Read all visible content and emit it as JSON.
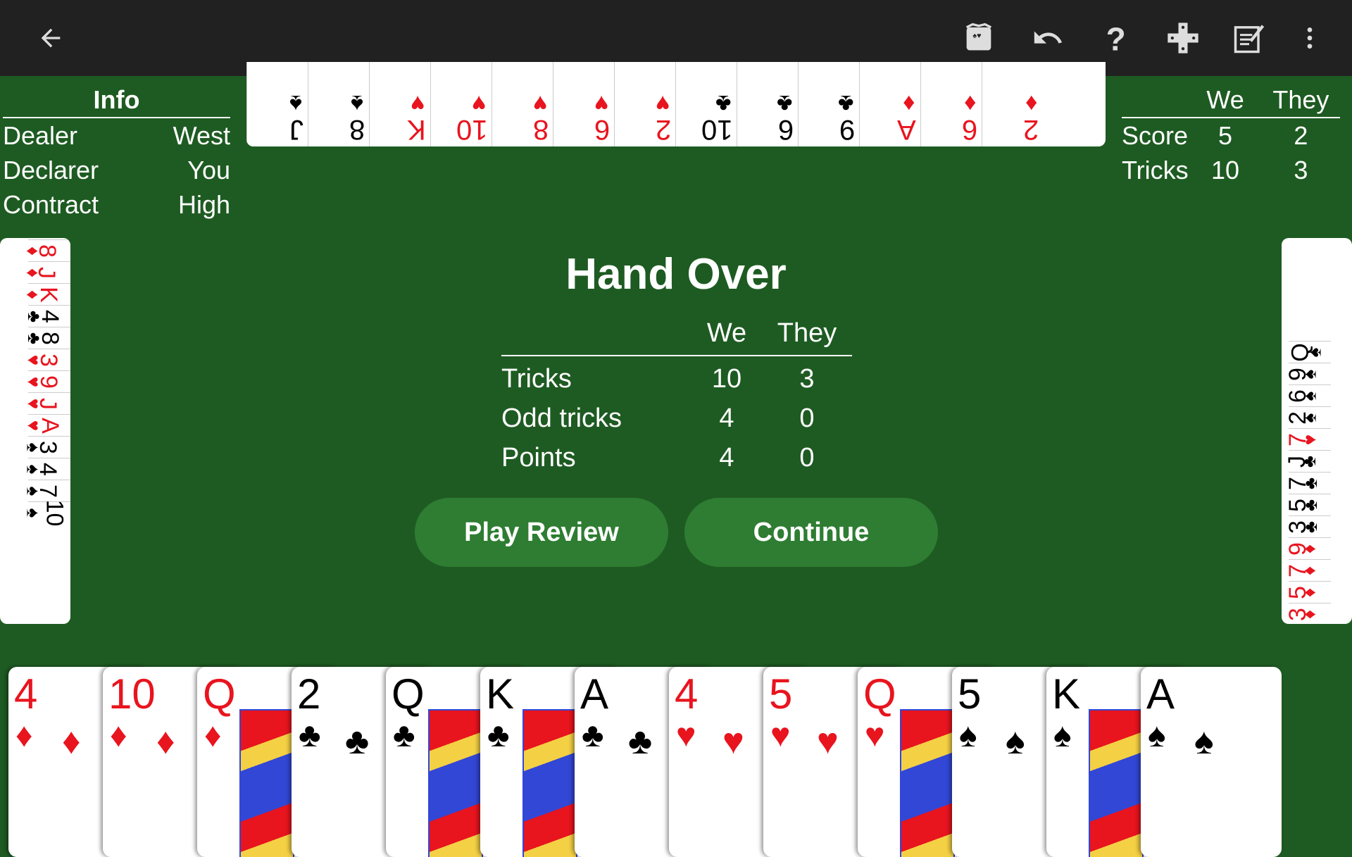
{
  "toolbar": {
    "icons": [
      "back-arrow-icon",
      "cards-icon",
      "undo-icon",
      "help-icon",
      "dpad-icon",
      "notes-icon",
      "more-vert-icon"
    ]
  },
  "info": {
    "header": "Info",
    "rows": [
      {
        "label": "Dealer",
        "value": "West"
      },
      {
        "label": "Declarer",
        "value": "You"
      },
      {
        "label": "Contract",
        "value": "High"
      }
    ]
  },
  "score": {
    "col_we": "We",
    "col_they": "They",
    "rows": [
      {
        "label": "Score",
        "we": "5",
        "they": "2"
      },
      {
        "label": "Tricks",
        "we": "10",
        "they": "3"
      }
    ]
  },
  "dialog": {
    "title": "Hand Over",
    "col_we": "We",
    "col_they": "They",
    "rows": [
      {
        "label": "Tricks",
        "we": "10",
        "they": "3"
      },
      {
        "label": "Odd tricks",
        "we": "4",
        "they": "0"
      },
      {
        "label": "Points",
        "we": "4",
        "they": "0"
      }
    ],
    "play_review": "Play Review",
    "continue": "Continue"
  },
  "north_hand": [
    {
      "rank": "J",
      "suit": "♠",
      "color": "blk"
    },
    {
      "rank": "8",
      "suit": "♠",
      "color": "blk"
    },
    {
      "rank": "K",
      "suit": "♥",
      "color": "red"
    },
    {
      "rank": "10",
      "suit": "♥",
      "color": "red"
    },
    {
      "rank": "8",
      "suit": "♥",
      "color": "red"
    },
    {
      "rank": "6",
      "suit": "♥",
      "color": "red"
    },
    {
      "rank": "2",
      "suit": "♥",
      "color": "red"
    },
    {
      "rank": "10",
      "suit": "♣",
      "color": "blk"
    },
    {
      "rank": "6",
      "suit": "♣",
      "color": "blk"
    },
    {
      "rank": "9",
      "suit": "♣",
      "color": "blk"
    },
    {
      "rank": "A",
      "suit": "♦",
      "color": "red"
    },
    {
      "rank": "6",
      "suit": "♦",
      "color": "red"
    },
    {
      "rank": "2",
      "suit": "♦",
      "color": "red"
    }
  ],
  "west_hand": [
    {
      "rank": "8",
      "suit": "♦",
      "color": "red"
    },
    {
      "rank": "J",
      "suit": "♦",
      "color": "red"
    },
    {
      "rank": "K",
      "suit": "♦",
      "color": "red"
    },
    {
      "rank": "4",
      "suit": "♣",
      "color": "blk"
    },
    {
      "rank": "8",
      "suit": "♣",
      "color": "blk"
    },
    {
      "rank": "3",
      "suit": "♥",
      "color": "red"
    },
    {
      "rank": "9",
      "suit": "♥",
      "color": "red"
    },
    {
      "rank": "J",
      "suit": "♥",
      "color": "red"
    },
    {
      "rank": "A",
      "suit": "♥",
      "color": "red"
    },
    {
      "rank": "3",
      "suit": "♠",
      "color": "blk"
    },
    {
      "rank": "4",
      "suit": "♠",
      "color": "blk"
    },
    {
      "rank": "7",
      "suit": "♠",
      "color": "blk"
    },
    {
      "rank": "10",
      "suit": "♠",
      "color": "blk"
    }
  ],
  "east_hand": [
    {
      "rank": "Q",
      "suit": "♠",
      "color": "blk"
    },
    {
      "rank": "9",
      "suit": "♠",
      "color": "blk"
    },
    {
      "rank": "6",
      "suit": "♠",
      "color": "blk"
    },
    {
      "rank": "2",
      "suit": "♠",
      "color": "blk"
    },
    {
      "rank": "7",
      "suit": "♥",
      "color": "red"
    },
    {
      "rank": "J",
      "suit": "♣",
      "color": "blk"
    },
    {
      "rank": "7",
      "suit": "♣",
      "color": "blk"
    },
    {
      "rank": "5",
      "suit": "♣",
      "color": "blk"
    },
    {
      "rank": "3",
      "suit": "♣",
      "color": "blk"
    },
    {
      "rank": "9",
      "suit": "♦",
      "color": "red"
    },
    {
      "rank": "7",
      "suit": "♦",
      "color": "red"
    },
    {
      "rank": "5",
      "suit": "♦",
      "color": "red"
    },
    {
      "rank": "3",
      "suit": "♦",
      "color": "red"
    }
  ],
  "south_hand": [
    {
      "rank": "4",
      "suit": "♦",
      "color": "red",
      "face": false
    },
    {
      "rank": "10",
      "suit": "♦",
      "color": "red",
      "face": false
    },
    {
      "rank": "Q",
      "suit": "♦",
      "color": "red",
      "face": true
    },
    {
      "rank": "2",
      "suit": "♣",
      "color": "blk",
      "face": false
    },
    {
      "rank": "Q",
      "suit": "♣",
      "color": "blk",
      "face": true
    },
    {
      "rank": "K",
      "suit": "♣",
      "color": "blk",
      "face": true
    },
    {
      "rank": "A",
      "suit": "♣",
      "color": "blk",
      "face": false
    },
    {
      "rank": "4",
      "suit": "♥",
      "color": "red",
      "face": false
    },
    {
      "rank": "5",
      "suit": "♥",
      "color": "red",
      "face": false
    },
    {
      "rank": "Q",
      "suit": "♥",
      "color": "red",
      "face": true
    },
    {
      "rank": "5",
      "suit": "♠",
      "color": "blk",
      "face": false
    },
    {
      "rank": "K",
      "suit": "♠",
      "color": "blk",
      "face": true
    },
    {
      "rank": "A",
      "suit": "♠",
      "color": "blk",
      "face": false
    }
  ]
}
